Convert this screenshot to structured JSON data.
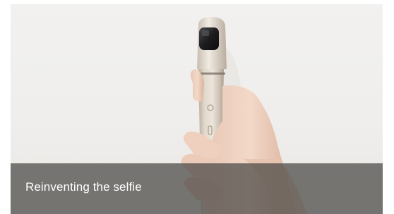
{
  "hero": {
    "image_subject": "hand holding a handheld 360 selfie camera",
    "caption": "Reinventing the selfie"
  },
  "colors": {
    "background": "#f0efed",
    "caption_overlay": "#484644",
    "caption_text": "#ffffff",
    "device_body": "#d9cfc2"
  }
}
